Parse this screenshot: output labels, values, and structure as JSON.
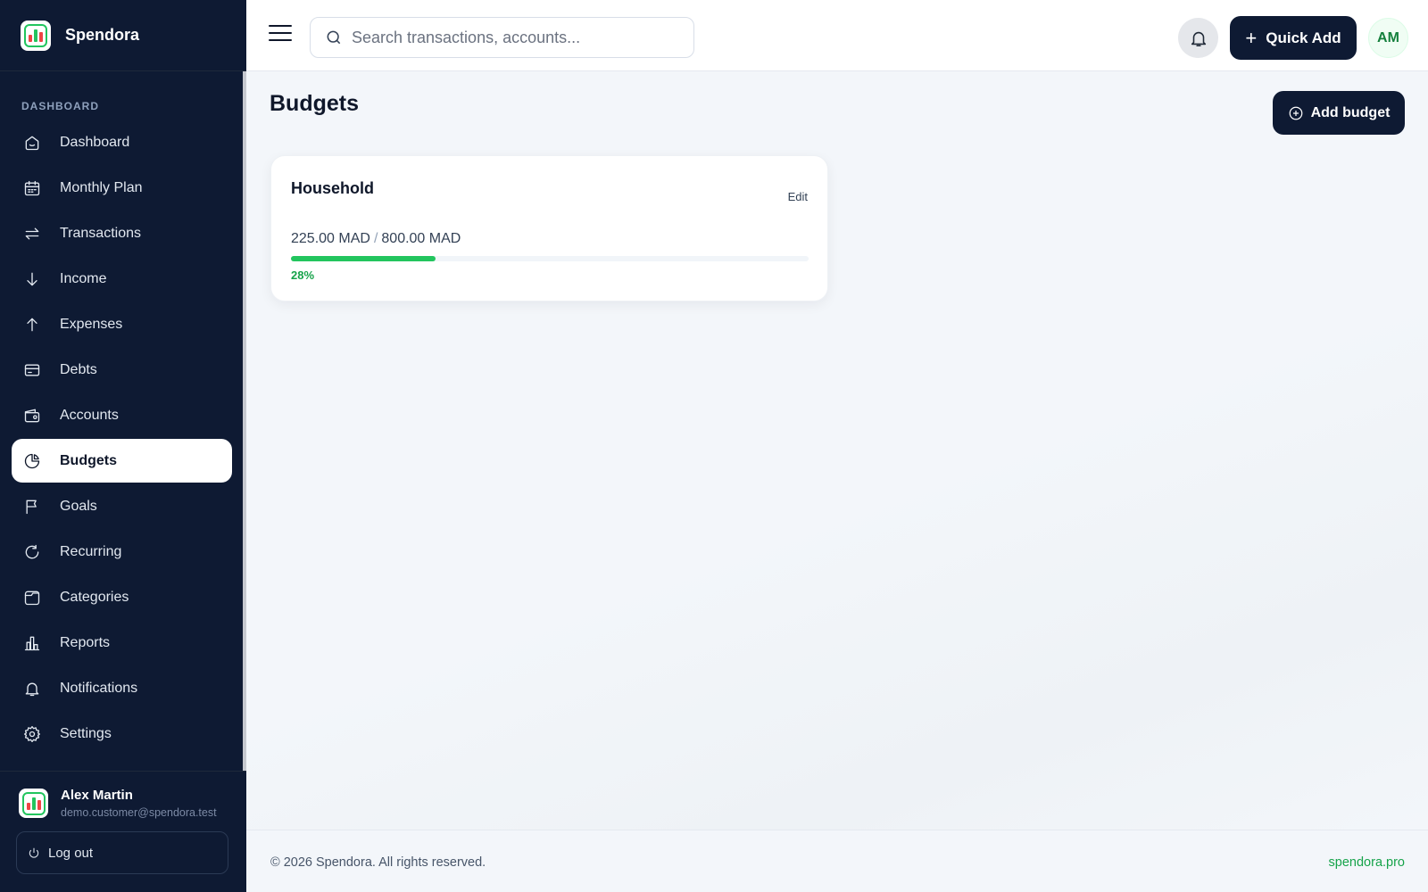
{
  "brand": {
    "name": "Spendora"
  },
  "sidebar": {
    "section_label": "DASHBOARD",
    "items": [
      {
        "label": "Dashboard",
        "icon": "home-icon"
      },
      {
        "label": "Monthly Plan",
        "icon": "calendar-icon"
      },
      {
        "label": "Transactions",
        "icon": "arrows-exchange-icon"
      },
      {
        "label": "Income",
        "icon": "arrow-down-icon"
      },
      {
        "label": "Expenses",
        "icon": "arrow-up-icon"
      },
      {
        "label": "Debts",
        "icon": "credit-card-icon"
      },
      {
        "label": "Accounts",
        "icon": "wallet-icon"
      },
      {
        "label": "Budgets",
        "icon": "pie-chart-icon",
        "active": true
      },
      {
        "label": "Goals",
        "icon": "flag-icon"
      },
      {
        "label": "Recurring",
        "icon": "refresh-icon"
      },
      {
        "label": "Categories",
        "icon": "folder-icon"
      },
      {
        "label": "Reports",
        "icon": "bar-chart-icon"
      },
      {
        "label": "Notifications",
        "icon": "bell-icon"
      },
      {
        "label": "Settings",
        "icon": "gear-icon"
      }
    ]
  },
  "user": {
    "name": "Alex Martin",
    "email": "demo.customer@spendora.test",
    "logout_label": "Log out",
    "initials": "AM"
  },
  "header": {
    "search_placeholder": "Search transactions, accounts...",
    "quick_add_label": "Quick Add"
  },
  "page": {
    "title": "Budgets",
    "add_button_label": "Add budget"
  },
  "budgets": [
    {
      "name": "Household",
      "edit_label": "Edit",
      "spent": "225.00 MAD",
      "separator": "/",
      "limit": "800.00 MAD",
      "percent_label": "28%",
      "progress": 0.28
    }
  ],
  "footer": {
    "copyright": "© 2026 Spendora. All rights reserved.",
    "link": "spendora.pro"
  },
  "colors": {
    "sidebar_bg": "#0e1a33",
    "accent_green": "#22c55e",
    "primary_button": "#0e1a33"
  }
}
